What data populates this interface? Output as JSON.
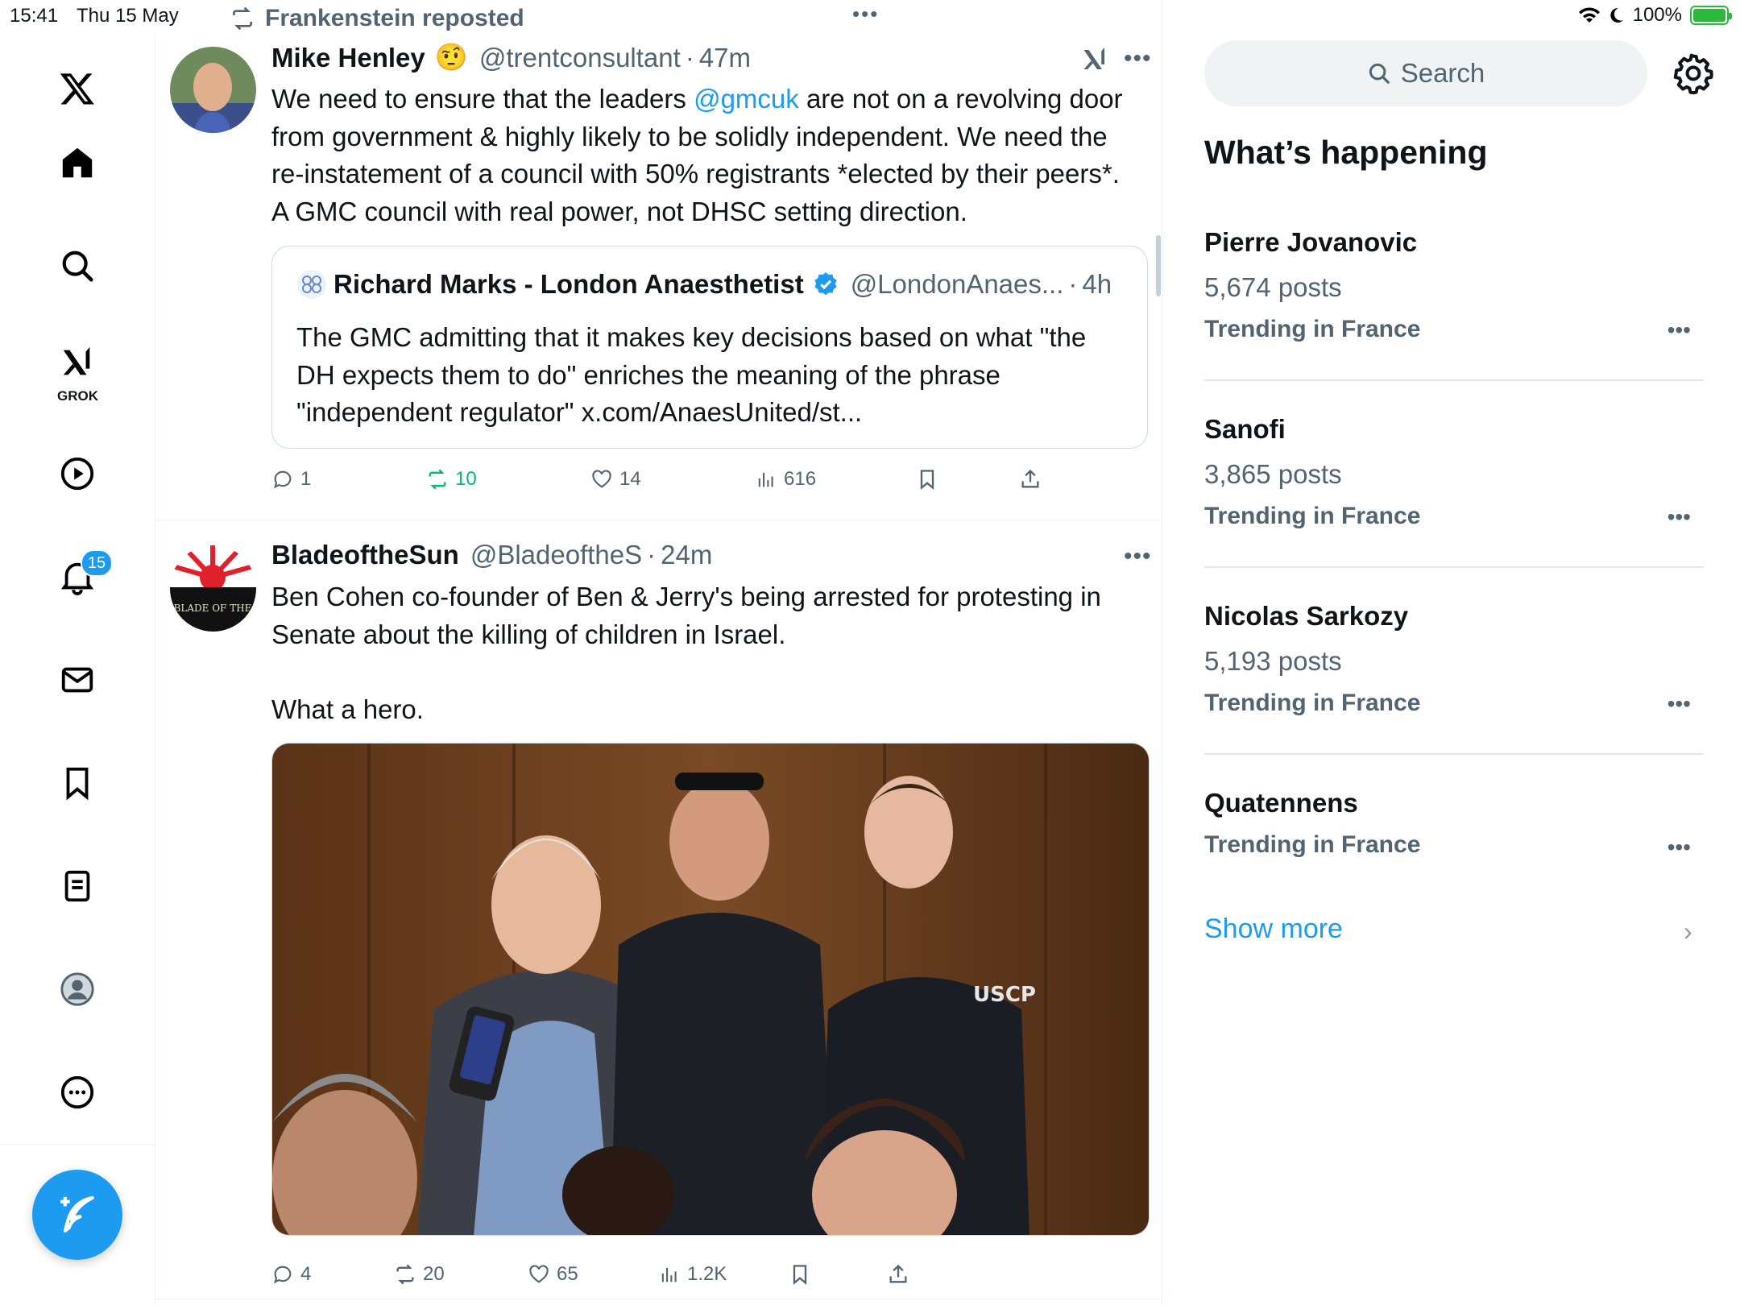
{
  "status_bar": {
    "time": "15:41",
    "date": "Thu 15 May",
    "battery": "100%"
  },
  "nav": {
    "grok_label": "GROK",
    "notification_count": "15"
  },
  "tweet1": {
    "repost_label": "Frankenstein reposted",
    "name": "Mike Henley",
    "emoji": "🤨",
    "handle": "@trentconsultant",
    "sep": "·",
    "time": "47m",
    "text_before": "We need to ensure that the leaders ",
    "mention": "@gmcuk",
    "text_after": " are not on a revolving door from government & highly likely to be solidly independent. We need the re-instatement of a council with 50% registrants *elected by their peers*. A GMC council with real power, not DHSC setting direction.",
    "quote": {
      "name": "Richard Marks - London Anaesthetist",
      "handle": "@LondonAnaes...",
      "sep": "·",
      "time": "4h",
      "text": "The GMC admitting that it makes key decisions based on what \"the DH expects them to do\"  enriches the meaning of the phrase \"independent regulator\" x.com/AnaesUnited/st..."
    },
    "replies": "1",
    "reposts": "10",
    "likes": "14",
    "views": "616"
  },
  "tweet2": {
    "name": "BladeoftheSun",
    "handle": "@BladeoftheS",
    "sep": "·",
    "time": "24m",
    "avatar_text": "BLADE OF THE",
    "text": "Ben Cohen co-founder of Ben & Jerry's being arrested for protesting in Senate about the killing of children in Israel.\n\nWhat a hero.",
    "image_badge": "USCP",
    "replies": "4",
    "reposts": "20",
    "likes": "65",
    "views": "1.2K"
  },
  "sidebar": {
    "search_placeholder": "Search",
    "title": "What’s happening",
    "trends": [
      {
        "name": "Pierre Jovanovic",
        "posts": "5,674 posts",
        "context": "Trending in France"
      },
      {
        "name": "Sanofi",
        "posts": "3,865 posts",
        "context": "Trending in France"
      },
      {
        "name": "Nicolas Sarkozy",
        "posts": "5,193 posts",
        "context": "Trending in France"
      },
      {
        "name": "Quatennens",
        "posts": "",
        "context": "Trending in France"
      }
    ],
    "show_more": "Show more"
  },
  "colors": {
    "accent": "#1d9bf0",
    "secondary_text": "#536471",
    "repost_green": "#00ba7c"
  }
}
